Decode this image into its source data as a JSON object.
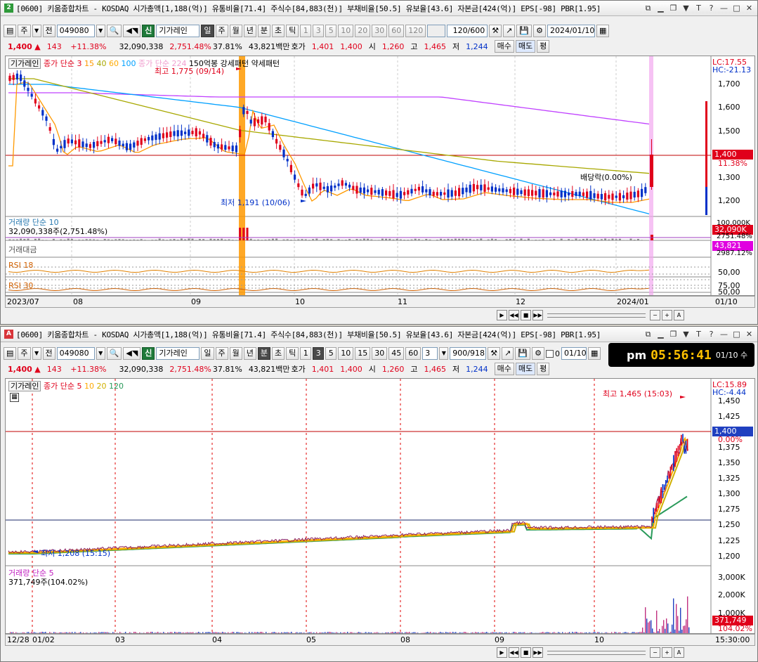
{
  "top": {
    "title": "[0600] 키움종합차트 - KOSDAQ 시가총액[1,188(억)] 유통비율[71.4] 주식수[84,883(천)] 부채비율[50.5] 유보율[43.6] 자본금[424(억)] EPS[-98] PBR[1.95]",
    "icon": "2",
    "toolbar": {
      "type": "주",
      "prev": "전",
      "code": "049080",
      "newbadge": "신",
      "name": "기가레인",
      "periods": [
        "일",
        "주",
        "월",
        "년",
        "분",
        "초",
        "틱"
      ],
      "active_period": "일",
      "nums": [
        "1",
        "3",
        "5",
        "10",
        "20",
        "30",
        "60",
        "120"
      ],
      "count": "120/600",
      "date": "2024/01/10"
    },
    "quote": {
      "price": "1,400",
      "arrow": "▲",
      "change": "143",
      "pct": "+11.38%",
      "volume": "32,090,338",
      "vol_pct": "2,751.48%",
      "turnover": "37.81%",
      "amount": "43,821백만",
      "hoga_lbl": "호가",
      "ask": "1,401",
      "bid": "1,400",
      "open_lbl": "시",
      "open": "1,260",
      "high_lbl": "고",
      "high": "1,465",
      "low_lbl": "저",
      "low": "1,244",
      "buy": "매수",
      "sell": "매도",
      "avg": "평"
    },
    "legend": {
      "name": "기가레인",
      "prefix": "종가 단순",
      "ma": [
        "3",
        "15",
        "40",
        "60",
        "100"
      ],
      "ma_hidden": "종가 단순 224",
      "extra": "150억봉 강세패턴 약세패턴"
    },
    "annot": {
      "high": "최고 1,775 (09/14)",
      "low": "최저 1,191 (10/06)",
      "div": "배당락(0.00%)"
    },
    "price_axis": [
      "1,700",
      "1,600",
      "1,500",
      "1,400",
      "1,300",
      "1,200"
    ],
    "lc": "LC:17.55",
    "hc": "HC:-21.13",
    "cur": "1,400",
    "cur_pct": "11.38%",
    "vol": {
      "label": "거래량 단순 10",
      "value": "32,090,338주(2,751.48%)",
      "axis": "100,000K",
      "tag": "32,090K",
      "tag2": "2751.48%"
    },
    "amt": {
      "label": "거래대금",
      "tag": "43,821",
      "tag2": "2987.12%"
    },
    "rsi18": {
      "label": "RSI 18",
      "axis": "50,00"
    },
    "rsi30": {
      "label": "RSI 30",
      "axis1": "75,00",
      "axis2": "50,00"
    },
    "dates": [
      "2023/07",
      "08",
      "09",
      "10",
      "11",
      "12",
      "2024/01"
    ],
    "date_end": "01/10"
  },
  "bottom": {
    "title": "[0600] 키움종합차트 - KOSDAQ 시가총액[1,188(억)] 유통비율[71.4] 주식수[84,883(천)] 부채비율[50.5] 유보율[43.6] 자본금[424(억)] EPS[-98] PBR[1.95]",
    "icon": "A",
    "toolbar": {
      "type": "주",
      "prev": "전",
      "code": "049080",
      "newbadge": "신",
      "name": "기가레인",
      "periods": [
        "일",
        "주",
        "월",
        "년",
        "분",
        "초",
        "틱"
      ],
      "active_period": "분",
      "nums": [
        "1",
        "3",
        "5",
        "10",
        "15",
        "30",
        "45",
        "60"
      ],
      "active_num": "3",
      "interval": "3",
      "count": "900/918",
      "chk": "0",
      "date": "01/10"
    },
    "quote": {
      "price": "1,400",
      "arrow": "▲",
      "change": "143",
      "pct": "+11.38%",
      "volume": "32,090,338",
      "vol_pct": "2,751.48%",
      "turnover": "37.81%",
      "amount": "43,821백만",
      "hoga_lbl": "호가",
      "ask": "1,401",
      "bid": "1,400",
      "open_lbl": "시",
      "open": "1,260",
      "high_lbl": "고",
      "high": "1,465",
      "low_lbl": "저",
      "low": "1,244",
      "buy": "매수",
      "sell": "매도",
      "avg": "평"
    },
    "legend": {
      "name": "기가레인",
      "prefix": "종가 단순",
      "ma": [
        "5",
        "10",
        "20",
        "120"
      ]
    },
    "annot": {
      "high": "최고 1,465 (15:03)",
      "low": "최저 1,208 (15:15)"
    },
    "price_axis": [
      "1,450",
      "1,425",
      "1,400",
      "1,375",
      "1,350",
      "1,325",
      "1,300",
      "1,275",
      "1,250",
      "1,225",
      "1,200"
    ],
    "lc": "LC:15.89",
    "hc": "HC:-4.44",
    "cur": "1,400",
    "cur_pct": "0.00%",
    "vol": {
      "label": "거래량 단순 5",
      "value": "371,749주(104.02%)",
      "axis": [
        "3,000K",
        "2,000K",
        "1,000K"
      ],
      "tag": "371,749",
      "tag2": "104.02%"
    },
    "dates": [
      "12/28",
      "01/02",
      "03",
      "04",
      "05",
      "08",
      "09",
      "10"
    ],
    "date_end": "15:30:00"
  },
  "clock": {
    "ampm": "pm",
    "time": "05:56:41",
    "date": "01/10 수"
  },
  "colors": {
    "up": "#e0001b",
    "down": "#0030c8",
    "ma3": "#e0001b",
    "ma15": "#ff9900",
    "ma40": "#a8a800",
    "ma60": "#00b0d0",
    "ma100": "#00a0ff",
    "ma224": "#c040ff"
  }
}
